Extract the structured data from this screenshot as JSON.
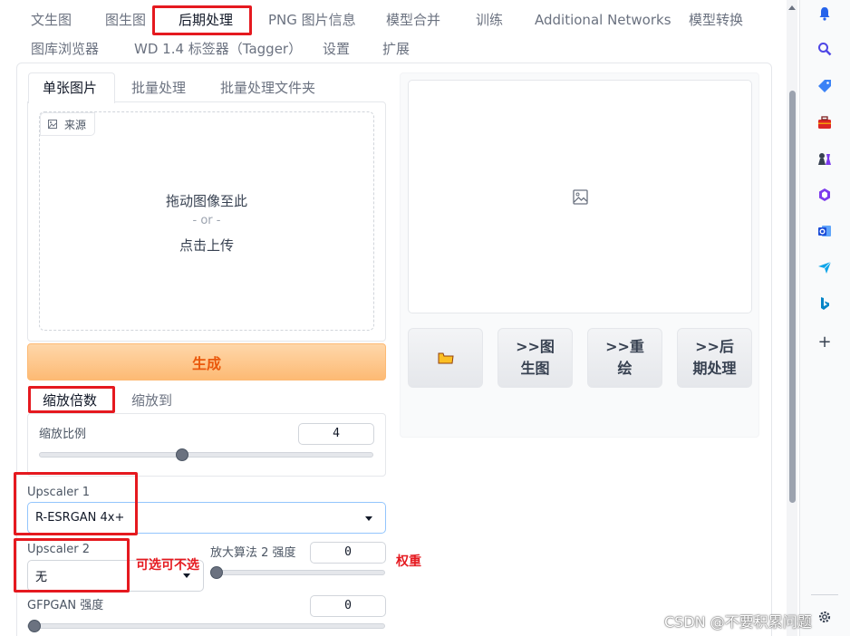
{
  "nav": {
    "row1": [
      "文生图",
      "图生图",
      "后期处理",
      "PNG 图片信息",
      "模型合并",
      "训练",
      "Additional Networks",
      "模型转换"
    ],
    "row2": [
      "图库浏览器",
      "WD 1.4 标签器（Tagger）",
      "设置",
      "扩展"
    ]
  },
  "left": {
    "tabs": [
      "单张图片",
      "批量处理",
      "批量处理文件夹"
    ],
    "source_label": "来源",
    "drop_text": "拖动图像至此",
    "or_text": "- or -",
    "upload_text": "点击上传",
    "generate_label": "生成",
    "scale_tabs": [
      "缩放倍数",
      "缩放到"
    ],
    "scale_ratio_label": "缩放比例",
    "scale_ratio_value": "4",
    "scale_ratio_fraction": 0.425,
    "upscaler1_label": "Upscaler 1",
    "upscaler1_value": "R-ESRGAN 4x+",
    "upscaler2_label": "Upscaler 2",
    "upscaler2_value": "无",
    "upscaler2_strength_label": "放大算法 2 强度",
    "upscaler2_strength_value": "0",
    "gfpgan_label": "GFPGAN 强度",
    "gfpgan_value": "0"
  },
  "right": {
    "folder_icon": "folder-icon",
    "buttons": [
      ">>图生图",
      ">>重绘",
      ">>后期处理"
    ],
    "button_lines": [
      [
        ">>图",
        "生图"
      ],
      [
        ">>重",
        "绘"
      ],
      [
        ">>后",
        "期处理"
      ]
    ]
  },
  "annotations": {
    "optional": "可选可不选",
    "weight": "权重"
  },
  "watermark": "CSDN @不要积累问题"
}
